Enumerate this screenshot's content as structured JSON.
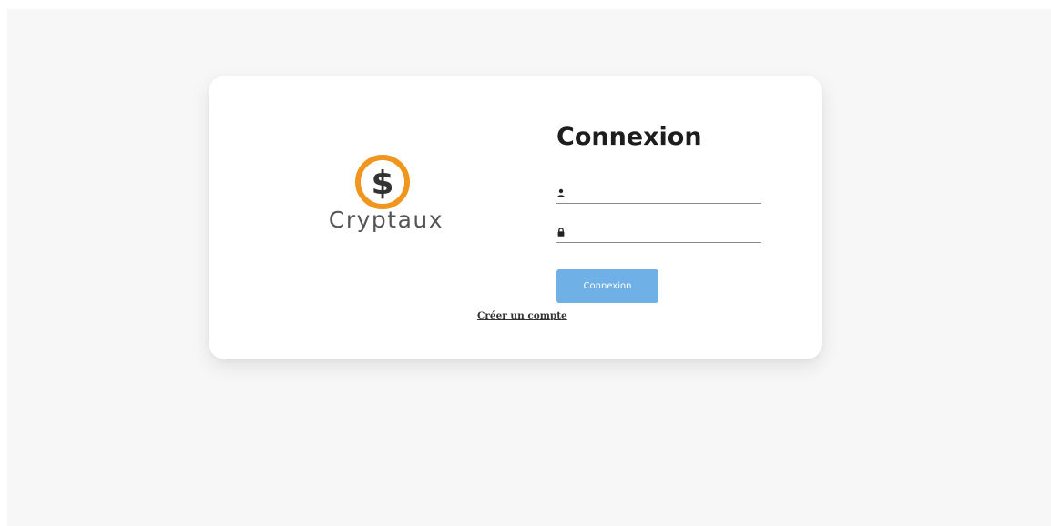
{
  "brand": {
    "name": "Cryptaux",
    "logo_icon": "dollar-coin-icon",
    "coin_symbol": "$",
    "coin_ring_color": "#f0961e",
    "coin_symbol_color": "#333333"
  },
  "login": {
    "title": "Connexion",
    "username": {
      "icon": "user-icon",
      "value": "",
      "placeholder": ""
    },
    "password": {
      "icon": "lock-icon",
      "value": "",
      "placeholder": ""
    },
    "submit_label": "Connexion",
    "submit_color": "#6fb0e6",
    "create_account_label": "Créer un compte"
  },
  "colors": {
    "page_background": "#f7f7f7",
    "card_background": "#ffffff",
    "title_text": "#1d1d1d"
  }
}
